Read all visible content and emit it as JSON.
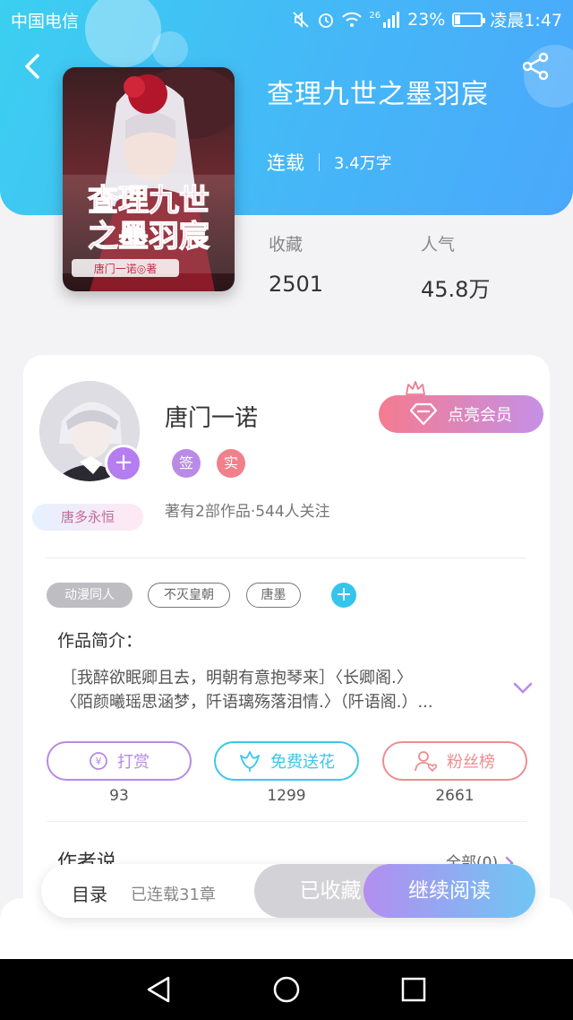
{
  "status_bar": {
    "carrier": "中国电信",
    "network": "26",
    "battery_percent": "23%",
    "time": "凌晨1:47",
    "battery_level": 0.23
  },
  "book": {
    "title": "查理九世之墨羽宸",
    "status": "连载",
    "words": "3.4万字",
    "cover_title": "查理九世之墨羽宸",
    "cover_author": "唐门一诺◎著"
  },
  "stats": {
    "favorites_label": "收藏",
    "favorites_value": "2501",
    "popularity_label": "人气",
    "popularity_value": "45.8万"
  },
  "author": {
    "name": "唐门一诺",
    "badge_sign": "签",
    "badge_real": "实",
    "info": "著有2部作品·544人关注",
    "fan_badge": "唐多永恒",
    "vip_button": "点亮会员"
  },
  "tags": [
    "动漫同人",
    "不灭皇朝",
    "唐墨"
  ],
  "intro": {
    "title": "作品简介：",
    "line1": "［我醉欲眠卿且去，明朝有意抱琴来］〈长卿阁.〉",
    "line2": "〈陌颜曦瑶思涵梦，阡语璃殇落泪情.〉（阡语阁.）..."
  },
  "actions": [
    {
      "label": "打赏",
      "count": "93",
      "color": "#b58be6"
    },
    {
      "label": "免费送花",
      "count": "1299",
      "color": "#3cc7e8"
    },
    {
      "label": "粉丝榜",
      "count": "2661",
      "color": "#f08c90"
    }
  ],
  "author_say": {
    "title": "作者说",
    "all_link": "全部(0)"
  },
  "bottom_bar": {
    "toc": "目录",
    "chapters": "已连载31章",
    "collected": "已收藏",
    "continue": "继续阅读"
  },
  "colors": {
    "header_start": "#3ccff0",
    "header_end": "#4aa8fb",
    "accent_purple": "#b47df0",
    "accent_cyan": "#35c5ea"
  }
}
